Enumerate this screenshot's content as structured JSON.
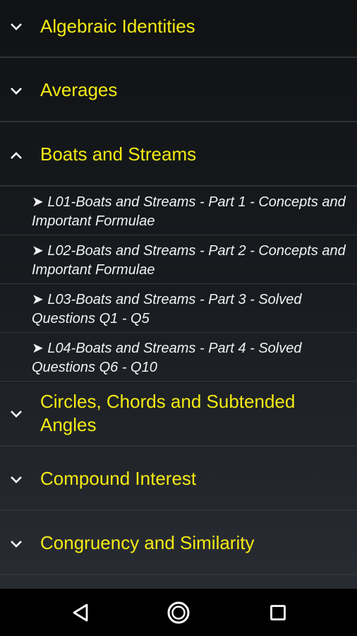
{
  "groups": [
    {
      "label": "Algebraic Identities",
      "icon": "chevron-down-icon",
      "expanded": false
    },
    {
      "label": "Averages",
      "icon": "chevron-down-icon",
      "expanded": false
    },
    {
      "label": "Boats and Streams",
      "icon": "chevron-up-icon",
      "expanded": true,
      "children": [
        {
          "label": "➤ L01-Boats and Streams - Part 1 - Concepts and Important Formulae"
        },
        {
          "label": "➤ L02-Boats and Streams - Part 2 - Concepts and Important Formulae"
        },
        {
          "label": "➤ L03-Boats and Streams - Part 3 - Solved Questions Q1 - Q5"
        },
        {
          "label": "➤ L04-Boats and Streams - Part 4 - Solved Questions Q6 - Q10"
        }
      ]
    },
    {
      "label": "Circles, Chords and Subtended Angles",
      "icon": "chevron-down-icon",
      "expanded": false
    },
    {
      "label": "Compound Interest",
      "icon": "chevron-down-icon",
      "expanded": false
    },
    {
      "label": "Congruency and Similarity",
      "icon": "chevron-down-icon",
      "expanded": false
    }
  ],
  "navbar": {
    "back_icon": "back-triangle-icon",
    "home_icon": "home-circle-icon",
    "recents_icon": "recents-square-icon"
  },
  "colors": {
    "group_label": "#f5ea14",
    "child_label": "#f2f2f2",
    "divider": "#2f3338",
    "navbar": "#000000"
  }
}
